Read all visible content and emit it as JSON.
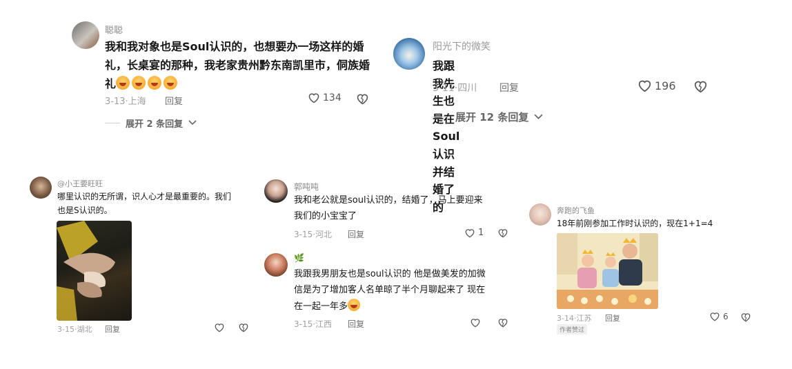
{
  "c1": {
    "name": "聪聪",
    "text": "我和我对象也是Soul认识的，也想要办一场这样的婚礼，长桌宴的那种，我老家贵州黔东南凯里市，侗族婚礼",
    "date": "3-13·上海",
    "reply": "回复",
    "likes": "134",
    "expand": "展开 2 条回复"
  },
  "c2": {
    "name": "阳光下的微笑",
    "text": "我跟我先生也是在Soul认识并结婚了的",
    "date": "3-11·四川",
    "reply": "回复",
    "likes": "196",
    "expand": "展开 12 条回复"
  },
  "c3": {
    "name": "@小王要旺旺",
    "text1": "哪里认识的无所谓，识人心才是最重要的。我们",
    "text2": "也是S认识的。",
    "date": "3-15·湖北",
    "reply": "回复"
  },
  "c4": {
    "name": "郭吨吨",
    "text1": "我和老公就是soul认识的，结婚了，马上要迎来",
    "text2": "我们的小宝宝了",
    "date": "3-15·河北",
    "reply": "回复",
    "likes": "1"
  },
  "c5": {
    "name": "🌿",
    "text1": "我跟我男朋友也是soul认识的 他是做美发的加微",
    "text2": "信是为了增加客人名单晾了半个月聊起来了 现在",
    "text3": "在一起一年多",
    "date": "3-15·江西",
    "reply": "回复"
  },
  "c6": {
    "name": "奔跑的飞鱼",
    "text": "18年前刚参加工作时认识的，现在1+1=4",
    "date": "3-14·江苏",
    "reply": "回复",
    "likes": "6",
    "badge": "作者赞过"
  }
}
